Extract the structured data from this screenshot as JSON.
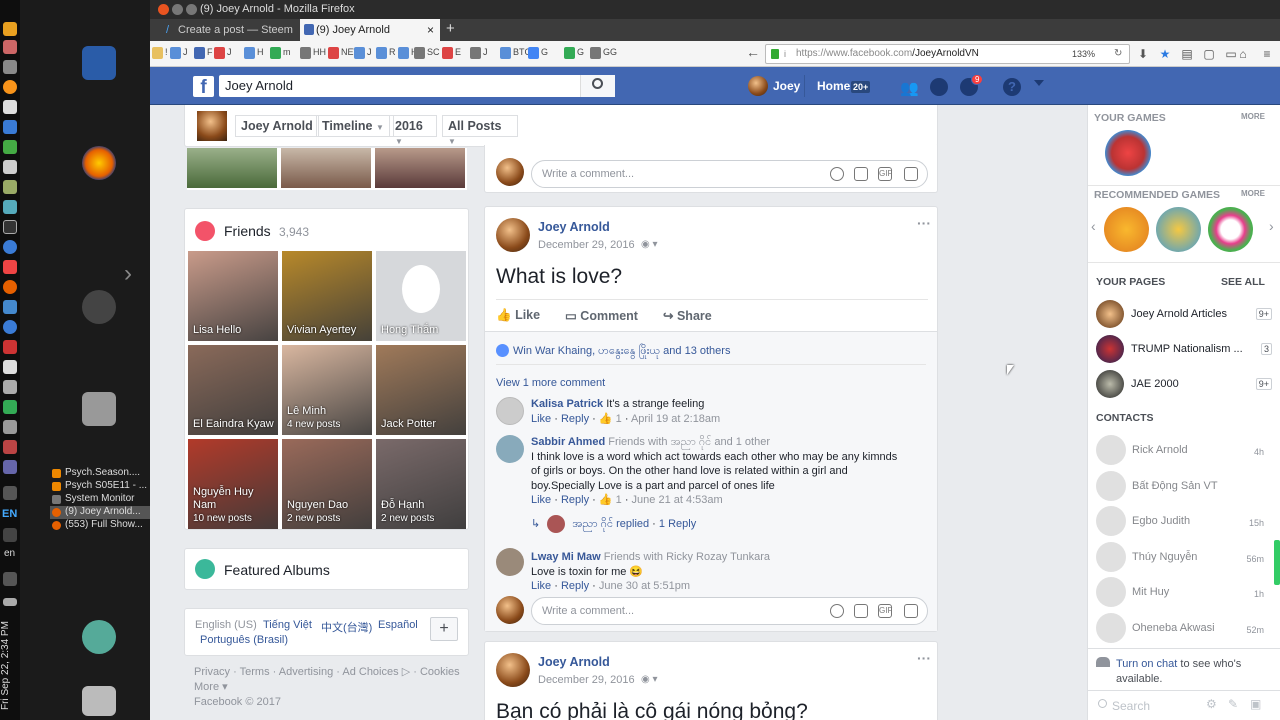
{
  "window": {
    "title": "(9) Joey Arnold - Mozilla Firefox",
    "tabs": [
      {
        "label": "Create a post — Steem"
      },
      {
        "label": "(9) Joey Arnold"
      }
    ],
    "url_host": "https://www.facebook.com",
    "url_path": "/JoeyArnoldVN",
    "zoom": "133%"
  },
  "bookmarks": [
    "!",
    "J",
    "F",
    "J",
    "H",
    "m",
    "HH",
    "NEW",
    "J",
    "R",
    "H",
    "SC",
    "E",
    "J",
    "BTC",
    "G",
    "G",
    "GG"
  ],
  "desktop": {
    "taskbar": [
      {
        "label": "Psych.Season....",
        "color": "#a33"
      },
      {
        "label": "Psych S05E11 - ...",
        "color": "#a33"
      },
      {
        "label": "System Monitor",
        "color": "#555"
      },
      {
        "label": "(9) Joey Arnold...",
        "color": "#e66000"
      },
      {
        "label": "(553) Full Show...",
        "color": "#e66000"
      }
    ],
    "lang": "EN",
    "lang2": "en",
    "clock": "Fri Sep 22, 2:34 PM"
  },
  "fb": {
    "logo": "f",
    "search_value": "Joey Arnold",
    "user": "Joey",
    "home": "Home",
    "home_badge": "20+",
    "notif_badge": "9"
  },
  "subnav": {
    "name": "Joey Arnold",
    "timeline": "Timeline",
    "year": "2016",
    "filter": "All Posts"
  },
  "friends": {
    "title": "Friends",
    "count": "3,943",
    "items": [
      {
        "name": "Lisa Hello",
        "sub": "",
        "color": "#c99b8a"
      },
      {
        "name": "Vivian Ayertey",
        "sub": "",
        "color": "#b8892a"
      },
      {
        "name": "Hong Thắm",
        "sub": "",
        "color": "#d0d3d6"
      },
      {
        "name": "El Eaindra Kyaw",
        "sub": "",
        "color": "#8a6a5a"
      },
      {
        "name": "Lê Minh",
        "sub": "4 new posts",
        "color": "#d9b7a0"
      },
      {
        "name": "Jack Potter",
        "sub": "",
        "color": "#a07a5a"
      },
      {
        "name": "Nguyễn Huy Nam",
        "sub": "10 new posts",
        "color": "#b23a2a"
      },
      {
        "name": "Nguyen Dao",
        "sub": "2 new posts",
        "color": "#9a6a5a"
      },
      {
        "name": "Đỗ Hạnh",
        "sub": "2 new posts",
        "color": "#7a6a6a"
      }
    ]
  },
  "albums": {
    "title": "Featured Albums"
  },
  "footer": {
    "lang_current": "English (US)",
    "langs": [
      "Tiếng Việt",
      "中文(台灣)",
      "Español",
      "Português (Brasil)"
    ],
    "links": [
      "Privacy",
      "Terms",
      "Advertising",
      "Ad Choices",
      "Cookies"
    ],
    "more": "More",
    "copyright": "Facebook © 2017"
  },
  "post1": {
    "author": "Joey Arnold",
    "date": "December 29, 2016",
    "text": "What is love?",
    "like": "Like",
    "comment": "Comment",
    "share": "Share",
    "reactions": "Win War Khaing, ဟနွေးနွေ ဖြိုးယု and 13 others",
    "view_more": "View 1 more comment",
    "comments": [
      {
        "author": "Kalisa Patrick",
        "text": "It's a strange feeling",
        "like": "Like",
        "reply": "Reply",
        "likes": "1",
        "time": "April 19 at 2:18am"
      },
      {
        "author": "Sabbir Ahmed",
        "meta": "Friends with အညာ ဂိုင် and 1 other",
        "text": "I think love is a word which act towards each other who may be any kimnds of girls or boys. On the other hand love is related within a girl and boy.Specially Love is a part and parcel of ones life",
        "like": "Like",
        "reply": "Reply",
        "likes": "1",
        "time": "June 21 at 4:53am",
        "replied": "အညာ ဂိုင် replied",
        "replies": "1 Reply"
      },
      {
        "author": "Lway Mi Maw",
        "meta": "Friends with Ricky Rozay Tunkara",
        "text": "Love is toxin for me 😆",
        "like": "Like",
        "reply": "Reply",
        "time": "June 30 at 5:51pm"
      }
    ],
    "write_comment": "Write a comment..."
  },
  "write_comment_top": "Write a comment...",
  "post2": {
    "author": "Joey Arnold",
    "date": "December 29, 2016",
    "text": "Bạn có phải là cô gái nóng bỏng?"
  },
  "right": {
    "your_games": "YOUR GAMES",
    "more": "MORE",
    "recommended": "RECOMMENDED GAMES",
    "more2": "MORE",
    "your_pages": "YOUR PAGES",
    "see_all": "SEE ALL",
    "pages": [
      {
        "name": "Joey Arnold Articles",
        "badge": "9+"
      },
      {
        "name": "TRUMP Nationalism ...",
        "badge": "3"
      },
      {
        "name": "JAE 2000",
        "badge": "9+"
      }
    ],
    "contacts_title": "CONTACTS",
    "contacts": [
      {
        "name": "Rick Arnold",
        "time": "4h"
      },
      {
        "name": "Bất Động Sản VT",
        "time": ""
      },
      {
        "name": "Egbo Judith",
        "time": "15h"
      },
      {
        "name": "Thúy Nguyễn",
        "time": "56m"
      },
      {
        "name": "Mit Huy",
        "time": "1h"
      },
      {
        "name": "Oheneba Akwasi",
        "time": "52m"
      }
    ],
    "chat_link": "Turn on chat",
    "chat_rest": "to see who's available.",
    "search": "Search"
  }
}
